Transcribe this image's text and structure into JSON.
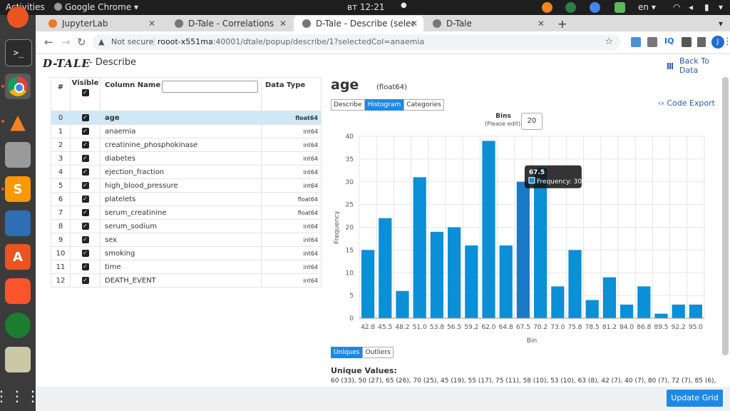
{
  "topbar": {
    "activities": "Activities",
    "app_name": "Google Chrome",
    "clock": "вт 12:21",
    "lang": "en"
  },
  "tabs": [
    {
      "label": "JupyterLab",
      "color": "#f37626"
    },
    {
      "label": "D-Tale - Correlations",
      "color": "#888888"
    },
    {
      "label": "D-Tale - Describe (selectec",
      "color": "#888888"
    },
    {
      "label": "D-Tale",
      "color": "#888888"
    }
  ],
  "address": {
    "security": "Not secure",
    "url_host": "rooot-x551ma",
    "url_rest": ":40001/dtale/popup/describe/1?selectedCol=anaemia"
  },
  "header": {
    "logo": "D-TALE",
    "title": "- Describe",
    "back": "Back To Data"
  },
  "table": {
    "headers": {
      "idx": "#",
      "visible": "Visible",
      "name": "Column Name",
      "type": "Data Type"
    },
    "rows": [
      {
        "idx": "0",
        "name": "age",
        "type": "float64"
      },
      {
        "idx": "1",
        "name": "anaemia",
        "type": "int64"
      },
      {
        "idx": "2",
        "name": "creatinine_phosphokinase",
        "type": "int64"
      },
      {
        "idx": "3",
        "name": "diabetes",
        "type": "int64"
      },
      {
        "idx": "4",
        "name": "ejection_fraction",
        "type": "int64"
      },
      {
        "idx": "5",
        "name": "high_blood_pressure",
        "type": "int64"
      },
      {
        "idx": "6",
        "name": "platelets",
        "type": "float64"
      },
      {
        "idx": "7",
        "name": "serum_creatinine",
        "type": "float64"
      },
      {
        "idx": "8",
        "name": "serum_sodium",
        "type": "int64"
      },
      {
        "idx": "9",
        "name": "sex",
        "type": "int64"
      },
      {
        "idx": "10",
        "name": "smoking",
        "type": "int64"
      },
      {
        "idx": "11",
        "name": "time",
        "type": "int64"
      },
      {
        "idx": "12",
        "name": "DEATH_EVENT",
        "type": "int64"
      }
    ]
  },
  "detail": {
    "column": "age",
    "dtype": "(float64)",
    "tabs": [
      "Describe",
      "Histogram",
      "Categories"
    ],
    "code_export": "Code Export",
    "bins_label": "Bins",
    "bins_sub": "(Please edit)",
    "bins_value": "20",
    "bottom_tabs": [
      "Uniques",
      "Outliers"
    ],
    "unique_title": "Unique Values:",
    "unique_values": "60 (33), 50 (27), 65 (26), 70 (25), 45 (19), 55 (17), 75 (11), 58 (10), 53 (10), 63 (8), 42 (7), 40 (7), 80 (7), 72 (7), 85 (6),",
    "update_grid": "Update Grid"
  },
  "chart_data": {
    "type": "bar",
    "categories": [
      "42.8",
      "45.5",
      "48.2",
      "51.0",
      "53.8",
      "56.5",
      "59.2",
      "62.0",
      "64.8",
      "67.5",
      "70.2",
      "73.0",
      "75.8",
      "78.5",
      "81.2",
      "84.0",
      "86.8",
      "89.5",
      "92.2",
      "95.0"
    ],
    "values": [
      15,
      22,
      6,
      31,
      19,
      20,
      16,
      39,
      16,
      30,
      33,
      7,
      15,
      4,
      9,
      3,
      7,
      1,
      3,
      3
    ],
    "xlabel": "Bin",
    "ylabel": "Frequency",
    "ylim": [
      0,
      40
    ],
    "yticks": [
      0,
      5,
      10,
      15,
      20,
      25,
      30,
      35,
      40
    ],
    "color": "#0b8fd6",
    "highlight_color": "#1a79c8",
    "tooltip": {
      "category": "67.5",
      "title": "67.5",
      "text": "Frequency: 30"
    },
    "grid": true
  }
}
